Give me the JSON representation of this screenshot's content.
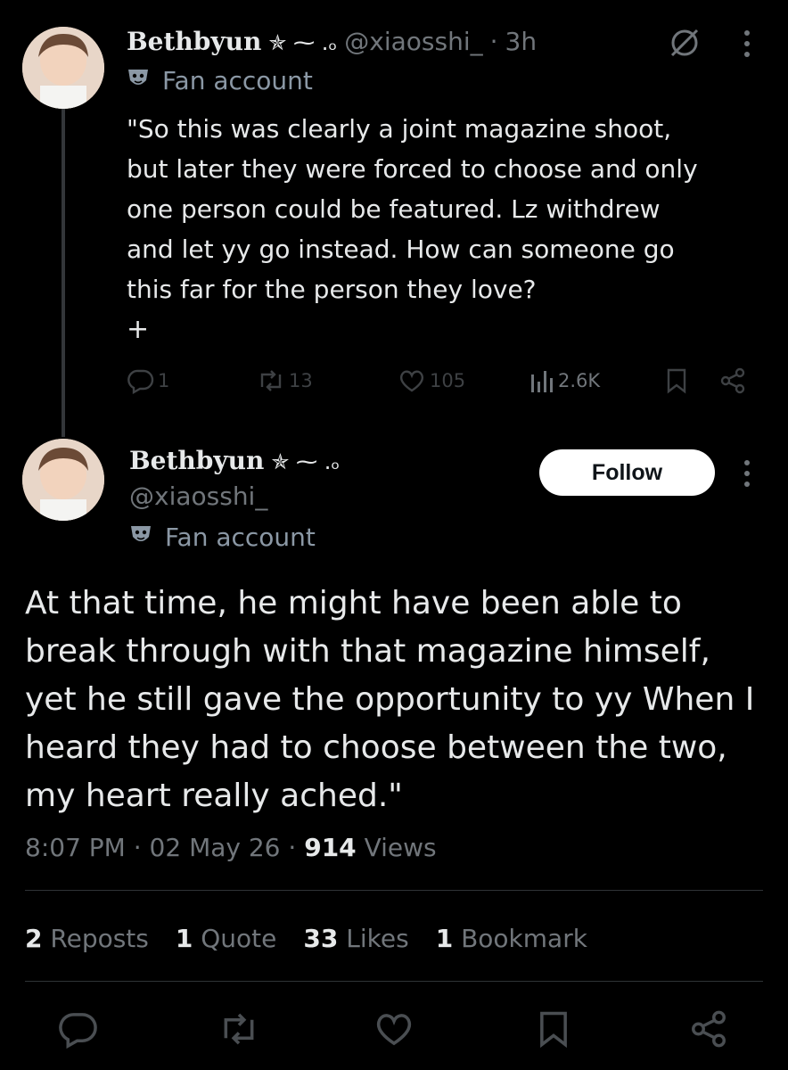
{
  "tweet1": {
    "display_name": "Bethbyun",
    "name_glyphs": "✯ ⁓ .ₒ",
    "handle": "@xiaosshi_",
    "time": "3h",
    "label_text": "Fan account",
    "text": "\"So this was clearly a joint magazine shoot,\nbut later they were forced to choose and only\none person could be featured. Lz withdrew\nand let yy go instead. How can someone go\nthis far for the person they love?",
    "plus": "+",
    "replies": "1",
    "reposts": "13",
    "likes": "105",
    "views": "2.6K"
  },
  "tweet2": {
    "display_name": "Bethbyun",
    "name_glyphs": "✯ ⁓ .ₒ",
    "handle": "@xiaosshi_",
    "label_text": "Fan account",
    "follow_label": "Follow",
    "text": "At that time, he might have been able to\nbreak through with that magazine himself,\nyet he still gave the opportunity to yy When I\nheard they had to choose between the two,\nmy heart really ached.\"",
    "time": "8:07 PM",
    "date": "02 May 26",
    "views_count": "914",
    "views_label": "Views",
    "stats": {
      "reposts_count": "2",
      "reposts_label": "Reposts",
      "quote_count": "1",
      "quote_label": "Quote",
      "likes_count": "33",
      "likes_label": "Likes",
      "bookmark_count": "1",
      "bookmark_label": "Bookmark"
    }
  },
  "icons": {
    "grok": "grok-icon",
    "more": "more-icon",
    "reply": "reply-icon",
    "repost": "repost-icon",
    "like": "heart-icon",
    "views": "views-icon",
    "bookmark": "bookmark-icon",
    "share": "share-icon",
    "label": "mask-icon"
  },
  "colors": {
    "background": "#000000",
    "text": "#e7e9ea",
    "muted": "#71767b",
    "faint": "#3e4144",
    "follow_bg": "#ffffff"
  }
}
